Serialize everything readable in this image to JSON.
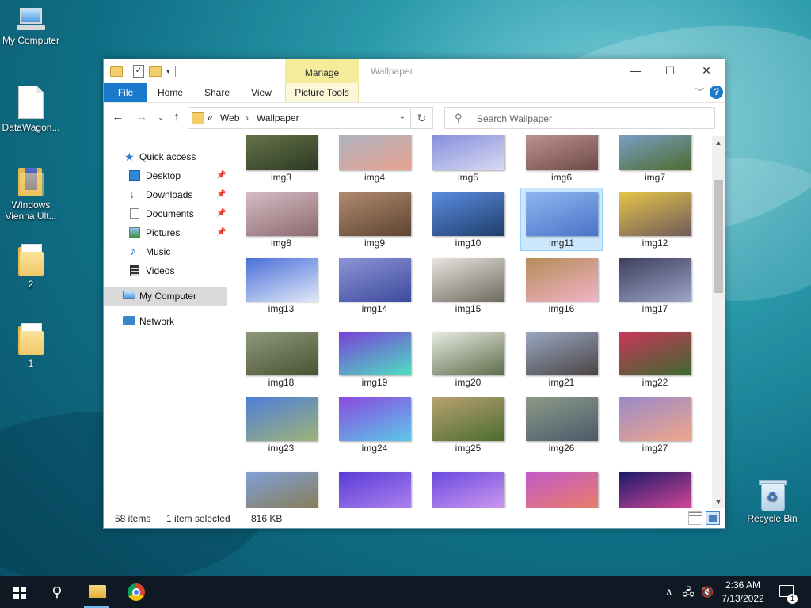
{
  "desktop": {
    "icons": [
      {
        "label": "My Computer"
      },
      {
        "label": "DataWagon..."
      },
      {
        "label": "Windows Vienna Ult..."
      },
      {
        "label": "2"
      },
      {
        "label": "1"
      },
      {
        "label": "Recycle Bin"
      }
    ]
  },
  "window": {
    "title": "Wallpaper",
    "manage_tab": "Manage",
    "ribbon_tabs": [
      "File",
      "Home",
      "Share",
      "View",
      "Picture Tools"
    ],
    "help": "?",
    "controls": {
      "minimize": "—",
      "maximize": "☐",
      "close": "✕"
    },
    "address": {
      "overflow": "«",
      "crumbs": [
        "Web",
        "Wallpaper"
      ]
    },
    "search_placeholder": "Search Wallpaper",
    "nav": {
      "quick_access": "Quick access",
      "items": [
        {
          "label": "Desktop",
          "icon": "desktop-icon",
          "pinned": true
        },
        {
          "label": "Downloads",
          "icon": "downloads-icon",
          "pinned": true
        },
        {
          "label": "Documents",
          "icon": "documents-icon",
          "pinned": true
        },
        {
          "label": "Pictures",
          "icon": "pictures-icon",
          "pinned": true
        },
        {
          "label": "Music",
          "icon": "music-icon",
          "pinned": false
        },
        {
          "label": "Videos",
          "icon": "videos-icon",
          "pinned": false
        }
      ],
      "my_computer": "My Computer",
      "network": "Network"
    },
    "files": [
      {
        "name": "img3",
        "colors": [
          "#6d7a4e",
          "#2d3a24"
        ]
      },
      {
        "name": "img4",
        "colors": [
          "#a8b6c8",
          "#e7a28f"
        ]
      },
      {
        "name": "img5",
        "colors": [
          "#7a83d8",
          "#d8dbf2"
        ]
      },
      {
        "name": "img6",
        "colors": [
          "#c89c99",
          "#6e4a44"
        ]
      },
      {
        "name": "img7",
        "colors": [
          "#7fa6d8",
          "#4d6b2f"
        ]
      },
      {
        "name": "img8",
        "colors": [
          "#d7bcc4",
          "#8b6a6f"
        ]
      },
      {
        "name": "img9",
        "colors": [
          "#b08a6e",
          "#5e4432"
        ]
      },
      {
        "name": "img10",
        "colors": [
          "#5b8ce0",
          "#1f3d6b"
        ]
      },
      {
        "name": "img11",
        "colors": [
          "#8fb6f0",
          "#4a73c9"
        ]
      },
      {
        "name": "img12",
        "colors": [
          "#e5c44a",
          "#6f5a5a"
        ]
      },
      {
        "name": "img13",
        "colors": [
          "#4a6fd8",
          "#dfe7f8"
        ]
      },
      {
        "name": "img14",
        "colors": [
          "#8c95d8",
          "#3d4a9c"
        ]
      },
      {
        "name": "img15",
        "colors": [
          "#e8e4e0",
          "#6e6a5e"
        ]
      },
      {
        "name": "img16",
        "colors": [
          "#b58c58",
          "#f2b2c8"
        ]
      },
      {
        "name": "img17",
        "colors": [
          "#3d3f5c",
          "#9ca4c9"
        ]
      },
      {
        "name": "img18",
        "colors": [
          "#8e9a7a",
          "#4a5234"
        ]
      },
      {
        "name": "img19",
        "colors": [
          "#7a3fd8",
          "#4de0c0"
        ]
      },
      {
        "name": "img20",
        "colors": [
          "#e7ece2",
          "#5e6b4a"
        ]
      },
      {
        "name": "img21",
        "colors": [
          "#9aa8c2",
          "#4a4444"
        ]
      },
      {
        "name": "img22",
        "colors": [
          "#c8365a",
          "#3d6a2f"
        ]
      },
      {
        "name": "img23",
        "colors": [
          "#4d7fd8",
          "#9fb27a"
        ]
      },
      {
        "name": "img24",
        "colors": [
          "#8a4ae0",
          "#5cc8e8"
        ]
      },
      {
        "name": "img25",
        "colors": [
          "#b8a270",
          "#4a6b2f"
        ]
      },
      {
        "name": "img26",
        "colors": [
          "#8c9a88",
          "#4a5a6a"
        ]
      },
      {
        "name": "img27",
        "colors": [
          "#9a8ac8",
          "#f0a68a"
        ]
      },
      {
        "name": "",
        "colors": [
          "#7fa0d8",
          "#8a7a4a"
        ]
      },
      {
        "name": "",
        "colors": [
          "#5a3ad8",
          "#b48af0"
        ]
      },
      {
        "name": "",
        "colors": [
          "#6a4ae0",
          "#d8a0f0"
        ]
      },
      {
        "name": "",
        "colors": [
          "#c05ac8",
          "#f08060"
        ]
      },
      {
        "name": "",
        "colors": [
          "#1a1a6a",
          "#e84a9a"
        ]
      }
    ],
    "status": {
      "count": "58 items",
      "selection": "1 item selected",
      "size": "816 KB"
    }
  },
  "taskbar": {
    "time": "2:36 AM",
    "date": "7/13/2022",
    "notifications": "1"
  },
  "colors": {
    "accent": "#1979ca",
    "manage_tab": "#f4eb9b",
    "selection": "#cce8ff",
    "taskbar": "#0f1923"
  }
}
